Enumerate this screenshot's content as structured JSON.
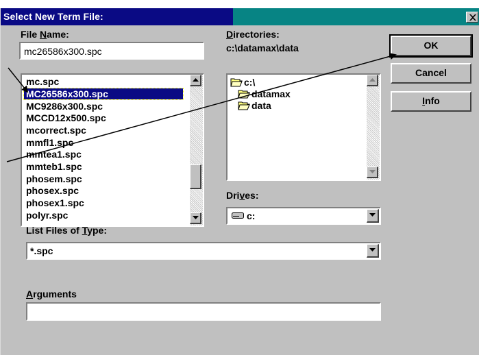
{
  "dialog": {
    "title": "Select New Term File:",
    "close_glyph": "✕"
  },
  "file_name": {
    "label_pre": "File ",
    "label_u": "N",
    "label_post": "ame:",
    "value": "mc26586x300.spc"
  },
  "files": [
    "mc.spc",
    "MC26586x300.spc",
    "MC9286x300.spc",
    "MCCD12x500.spc",
    "mcorrect.spc",
    "mmfl1.spc",
    "mmtea1.spc",
    "mmteb1.spc",
    "phosem.spc",
    "phosex.spc",
    "phosex1.spc",
    "polyr.spc"
  ],
  "selected_file_index": 1,
  "directories": {
    "label_u": "D",
    "label_post": "irectories:",
    "current_path": "c:\\datamax\\data",
    "items": [
      "c:\\",
      "datamax",
      "data"
    ]
  },
  "drives": {
    "label_pre": "Dri",
    "label_u": "v",
    "label_post": "es:",
    "value": "c:"
  },
  "file_type": {
    "label_pre": "List Files of ",
    "label_u": "T",
    "label_post": "ype:",
    "value": "*.spc"
  },
  "arguments": {
    "label_u": "A",
    "label_post": "rguments",
    "value": ""
  },
  "buttons": {
    "ok": "OK",
    "cancel": "Cancel",
    "info_u": "I",
    "info_post": "nfo"
  },
  "colors": {
    "title_active": "#0a0a84",
    "title_inactive": "#078484",
    "face": "#c0c0c0",
    "selection": "#0a0a84"
  }
}
